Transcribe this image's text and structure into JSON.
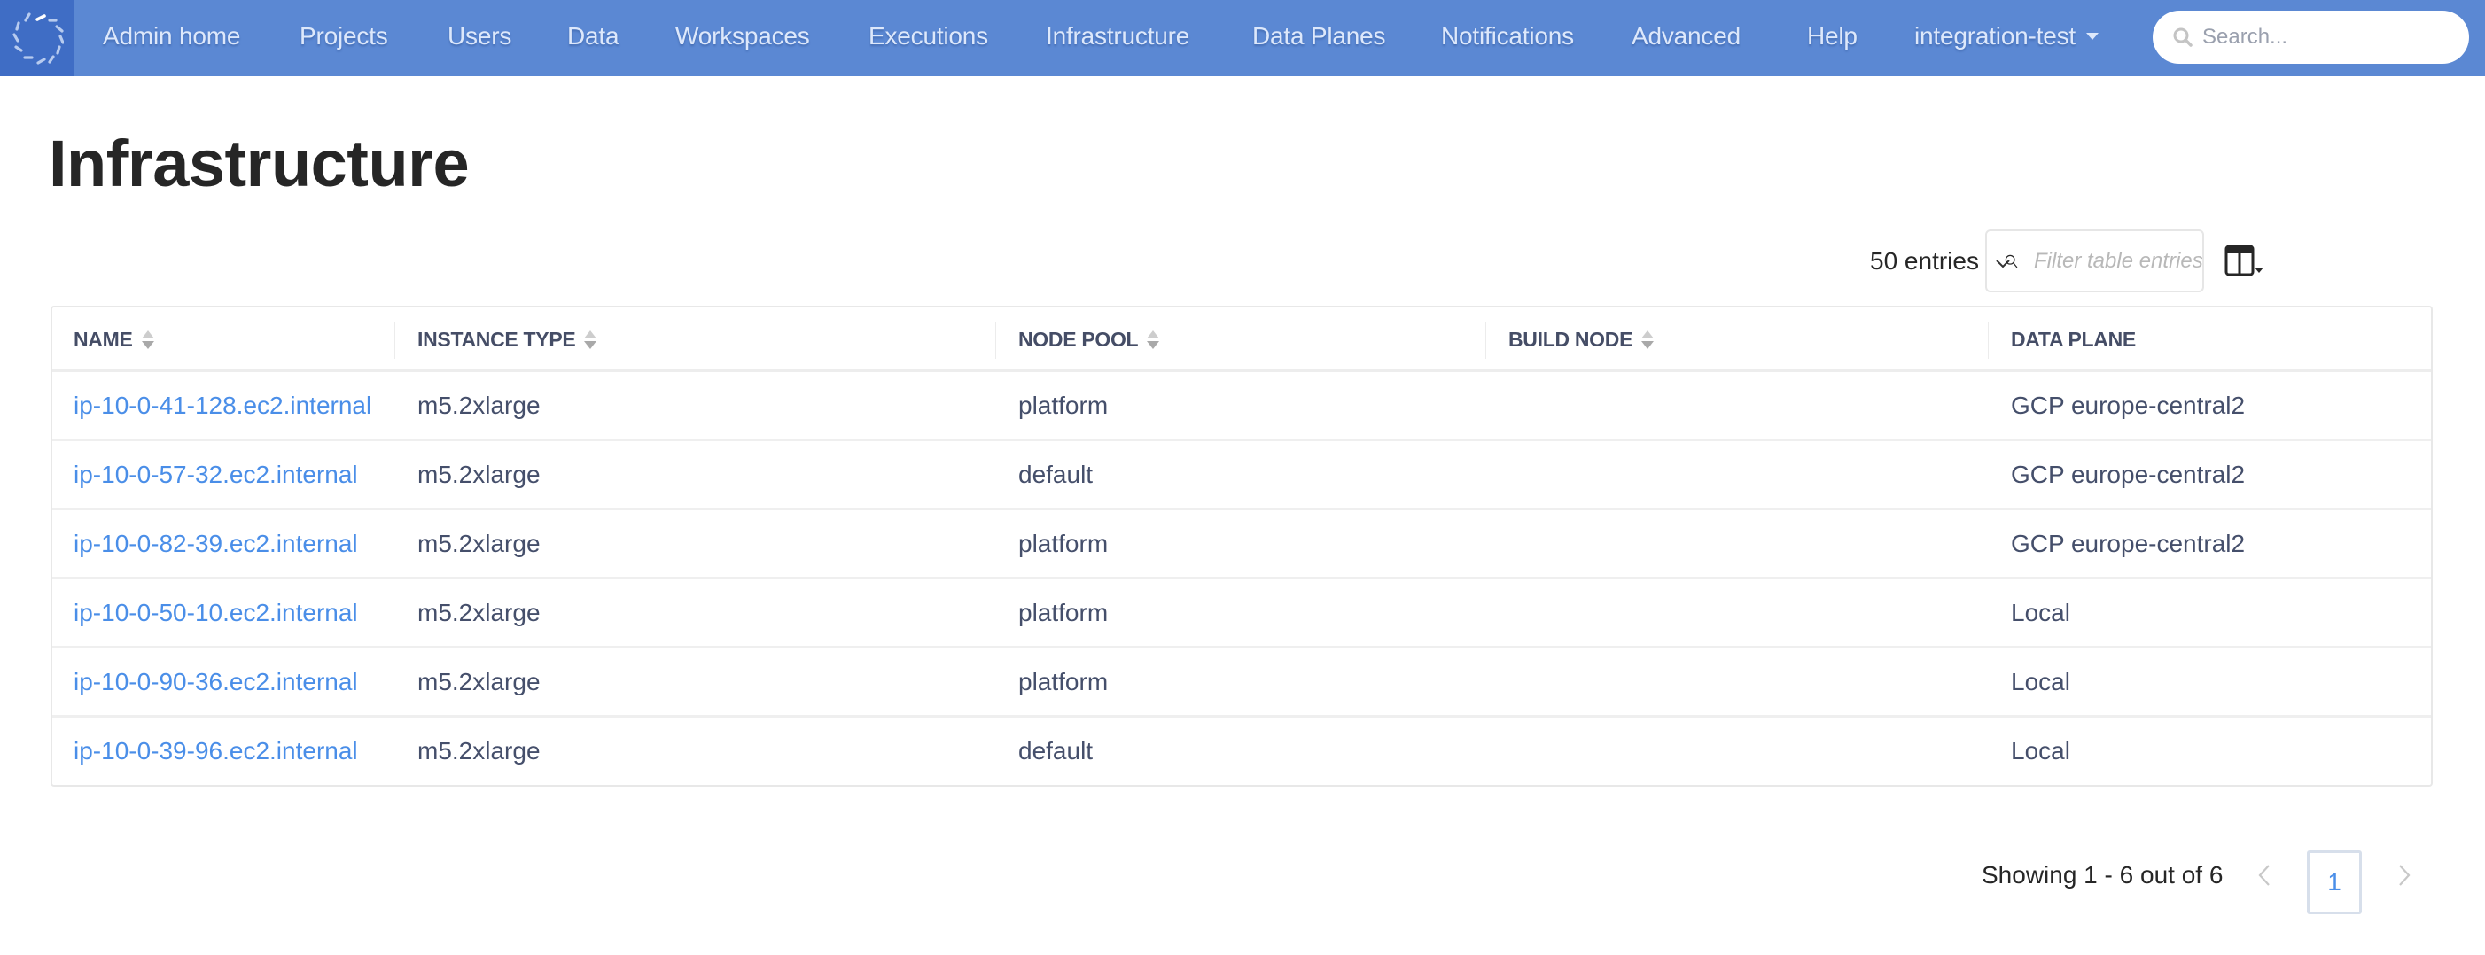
{
  "nav": {
    "logo_icon": "spinner-logo-icon",
    "items": [
      {
        "label": "Admin home"
      },
      {
        "label": "Projects"
      },
      {
        "label": "Users"
      },
      {
        "label": "Data"
      },
      {
        "label": "Workspaces"
      },
      {
        "label": "Executions"
      },
      {
        "label": "Infrastructure"
      },
      {
        "label": "Data Planes"
      },
      {
        "label": "Notifications"
      },
      {
        "label": "Advanced"
      },
      {
        "label": "Help"
      }
    ],
    "org_dropdown": {
      "label": "integration-test",
      "icon": "caret-down-icon"
    },
    "search": {
      "placeholder": "Search...",
      "value": "",
      "icon": "search-icon"
    },
    "colors": {
      "bar": "#5b88d3",
      "logo_bg": "#3f6dc5",
      "text": "#dde8fb"
    }
  },
  "page": {
    "title": "Infrastructure"
  },
  "controls": {
    "entries_label": "50 entries",
    "entries_icon": "chevron-down-icon",
    "filter": {
      "placeholder": "Filter table entries...",
      "value": "",
      "icon": "search-icon"
    },
    "column_toggle_icon": "columns-icon"
  },
  "table": {
    "columns": [
      {
        "label": "NAME",
        "sortable": true
      },
      {
        "label": "INSTANCE TYPE",
        "sortable": true
      },
      {
        "label": "NODE POOL",
        "sortable": true
      },
      {
        "label": "BUILD NODE",
        "sortable": true
      },
      {
        "label": "DATA PLANE",
        "sortable": false
      }
    ],
    "rows": [
      {
        "name": "ip-10-0-41-128.ec2.internal",
        "instance_type": "m5.2xlarge",
        "node_pool": "platform",
        "build_node": "",
        "data_plane": "GCP europe-central2"
      },
      {
        "name": "ip-10-0-57-32.ec2.internal",
        "instance_type": "m5.2xlarge",
        "node_pool": "default",
        "build_node": "",
        "data_plane": "GCP europe-central2"
      },
      {
        "name": "ip-10-0-82-39.ec2.internal",
        "instance_type": "m5.2xlarge",
        "node_pool": "platform",
        "build_node": "",
        "data_plane": "GCP europe-central2"
      },
      {
        "name": "ip-10-0-50-10.ec2.internal",
        "instance_type": "m5.2xlarge",
        "node_pool": "platform",
        "build_node": "",
        "data_plane": "Local"
      },
      {
        "name": "ip-10-0-90-36.ec2.internal",
        "instance_type": "m5.2xlarge",
        "node_pool": "platform",
        "build_node": "",
        "data_plane": "Local"
      },
      {
        "name": "ip-10-0-39-96.ec2.internal",
        "instance_type": "m5.2xlarge",
        "node_pool": "default",
        "build_node": "",
        "data_plane": "Local"
      }
    ],
    "colors": {
      "link": "#4a8ee8",
      "text": "#454f6b",
      "header": "#454d66"
    }
  },
  "pagination": {
    "summary": "Showing 1 - 6 out of 6",
    "current_page": "1",
    "prev_icon": "chevron-left-icon",
    "next_icon": "chevron-right-icon"
  }
}
